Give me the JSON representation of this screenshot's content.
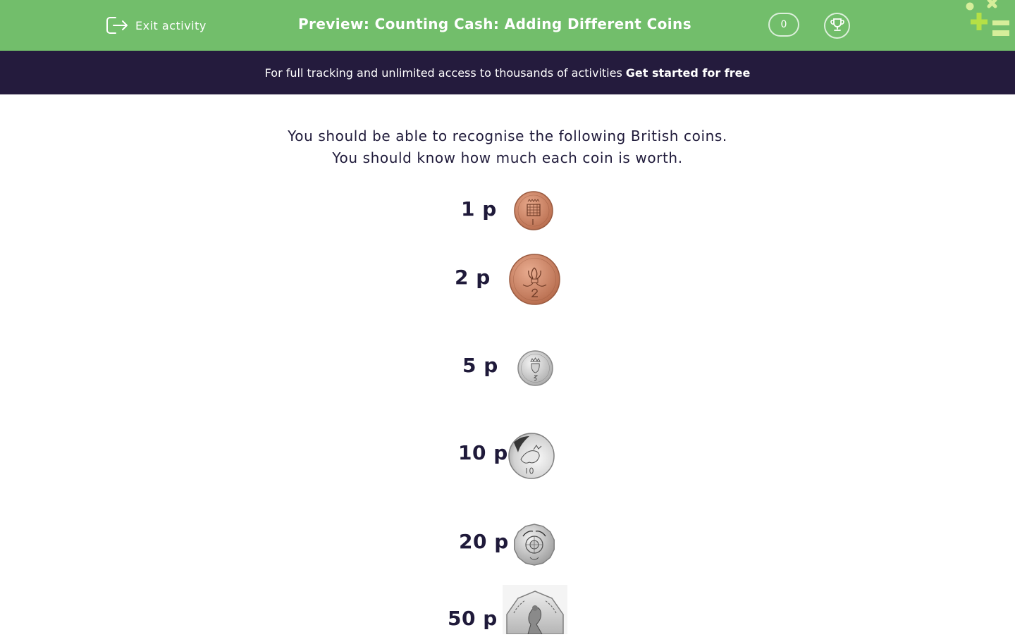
{
  "header": {
    "exit_label": "Exit activity",
    "title": "Preview: Counting Cash: Adding Different Coins",
    "score": "0",
    "trophy_icon": "trophy-icon",
    "logo_icon": "edplace-logo-icon",
    "brand_color": "#72be6b"
  },
  "promo": {
    "text": "For full tracking and unlimited access to thousands of activities",
    "cta": "Get started for free",
    "background": "#241b3d"
  },
  "content": {
    "line1": "You should be able to recognise the following British coins.",
    "line2": "You should know how much each coin is worth.",
    "coins": [
      {
        "label": "1 p",
        "icon": "one-penny-coin-icon",
        "metal": "bronze"
      },
      {
        "label": "2 p",
        "icon": "two-pence-coin-icon",
        "metal": "bronze"
      },
      {
        "label": "5 p",
        "icon": "five-pence-coin-icon",
        "metal": "silver"
      },
      {
        "label": "10 p",
        "icon": "ten-pence-coin-icon",
        "metal": "silver"
      },
      {
        "label": "20 p",
        "icon": "twenty-pence-coin-icon",
        "metal": "silver"
      },
      {
        "label": "50 p",
        "icon": "fifty-pence-coin-icon",
        "metal": "silver"
      }
    ]
  }
}
